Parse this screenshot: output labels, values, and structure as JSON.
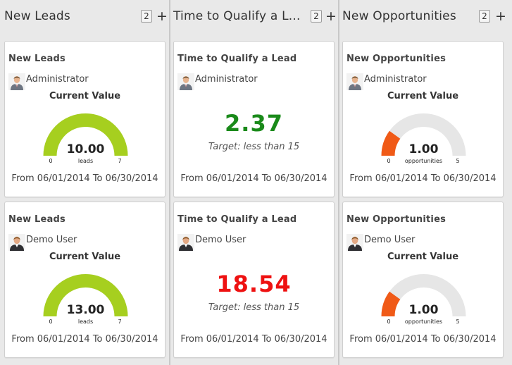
{
  "columns": [
    {
      "title": "New Leads",
      "count": "2",
      "add_label": "+",
      "cards": [
        {
          "title": "New Leads",
          "user": "Administrator",
          "value_label": "Current Value",
          "gauge": {
            "value": 10,
            "value_text": "10.00",
            "min_label": "0",
            "max_label": "7",
            "unit": "leads",
            "fraction": 1.0,
            "color": "#a6cf1f"
          },
          "date_range": "From 06/01/2014 To 06/30/2014"
        },
        {
          "title": "New Leads",
          "user": "Demo User",
          "value_label": "Current Value",
          "gauge": {
            "value": 13,
            "value_text": "13.00",
            "min_label": "0",
            "max_label": "7",
            "unit": "leads",
            "fraction": 1.0,
            "color": "#a6cf1f"
          },
          "date_range": "From 06/01/2014 To 06/30/2014"
        }
      ]
    },
    {
      "title": "Time to Qualify a L...",
      "count": "2",
      "add_label": "+",
      "cards": [
        {
          "title": "Time to Qualify a Lead",
          "user": "Administrator",
          "kpi": {
            "value": "2.37",
            "color": "#1a8a1a",
            "target": "Target: less than 15"
          },
          "date_range": "From 06/01/2014 To 06/30/2014"
        },
        {
          "title": "Time to Qualify a Lead",
          "user": "Demo User",
          "kpi": {
            "value": "18.54",
            "color": "#ee1111",
            "target": "Target: less than 15"
          },
          "date_range": "From 06/01/2014 To 06/30/2014"
        }
      ]
    },
    {
      "title": "New Opportunities",
      "count": "2",
      "add_label": "+",
      "cards": [
        {
          "title": "New Opportunities",
          "user": "Administrator",
          "value_label": "Current Value",
          "gauge": {
            "value": 1,
            "value_text": "1.00",
            "min_label": "0",
            "max_label": "5",
            "unit": "opportunities",
            "fraction": 0.2,
            "color": "#f05a17"
          },
          "date_range": "From 06/01/2014 To 06/30/2014"
        },
        {
          "title": "New Opportunities",
          "user": "Demo User",
          "value_label": "Current Value",
          "gauge": {
            "value": 1,
            "value_text": "1.00",
            "min_label": "0",
            "max_label": "5",
            "unit": "opportunities",
            "fraction": 0.2,
            "color": "#f05a17"
          },
          "date_range": "From 06/01/2014 To 06/30/2014"
        }
      ]
    }
  ],
  "colors": {
    "gauge_track": "#e6e6e6",
    "panel_background": "#e9e9e9",
    "card_background": "#ffffff"
  }
}
